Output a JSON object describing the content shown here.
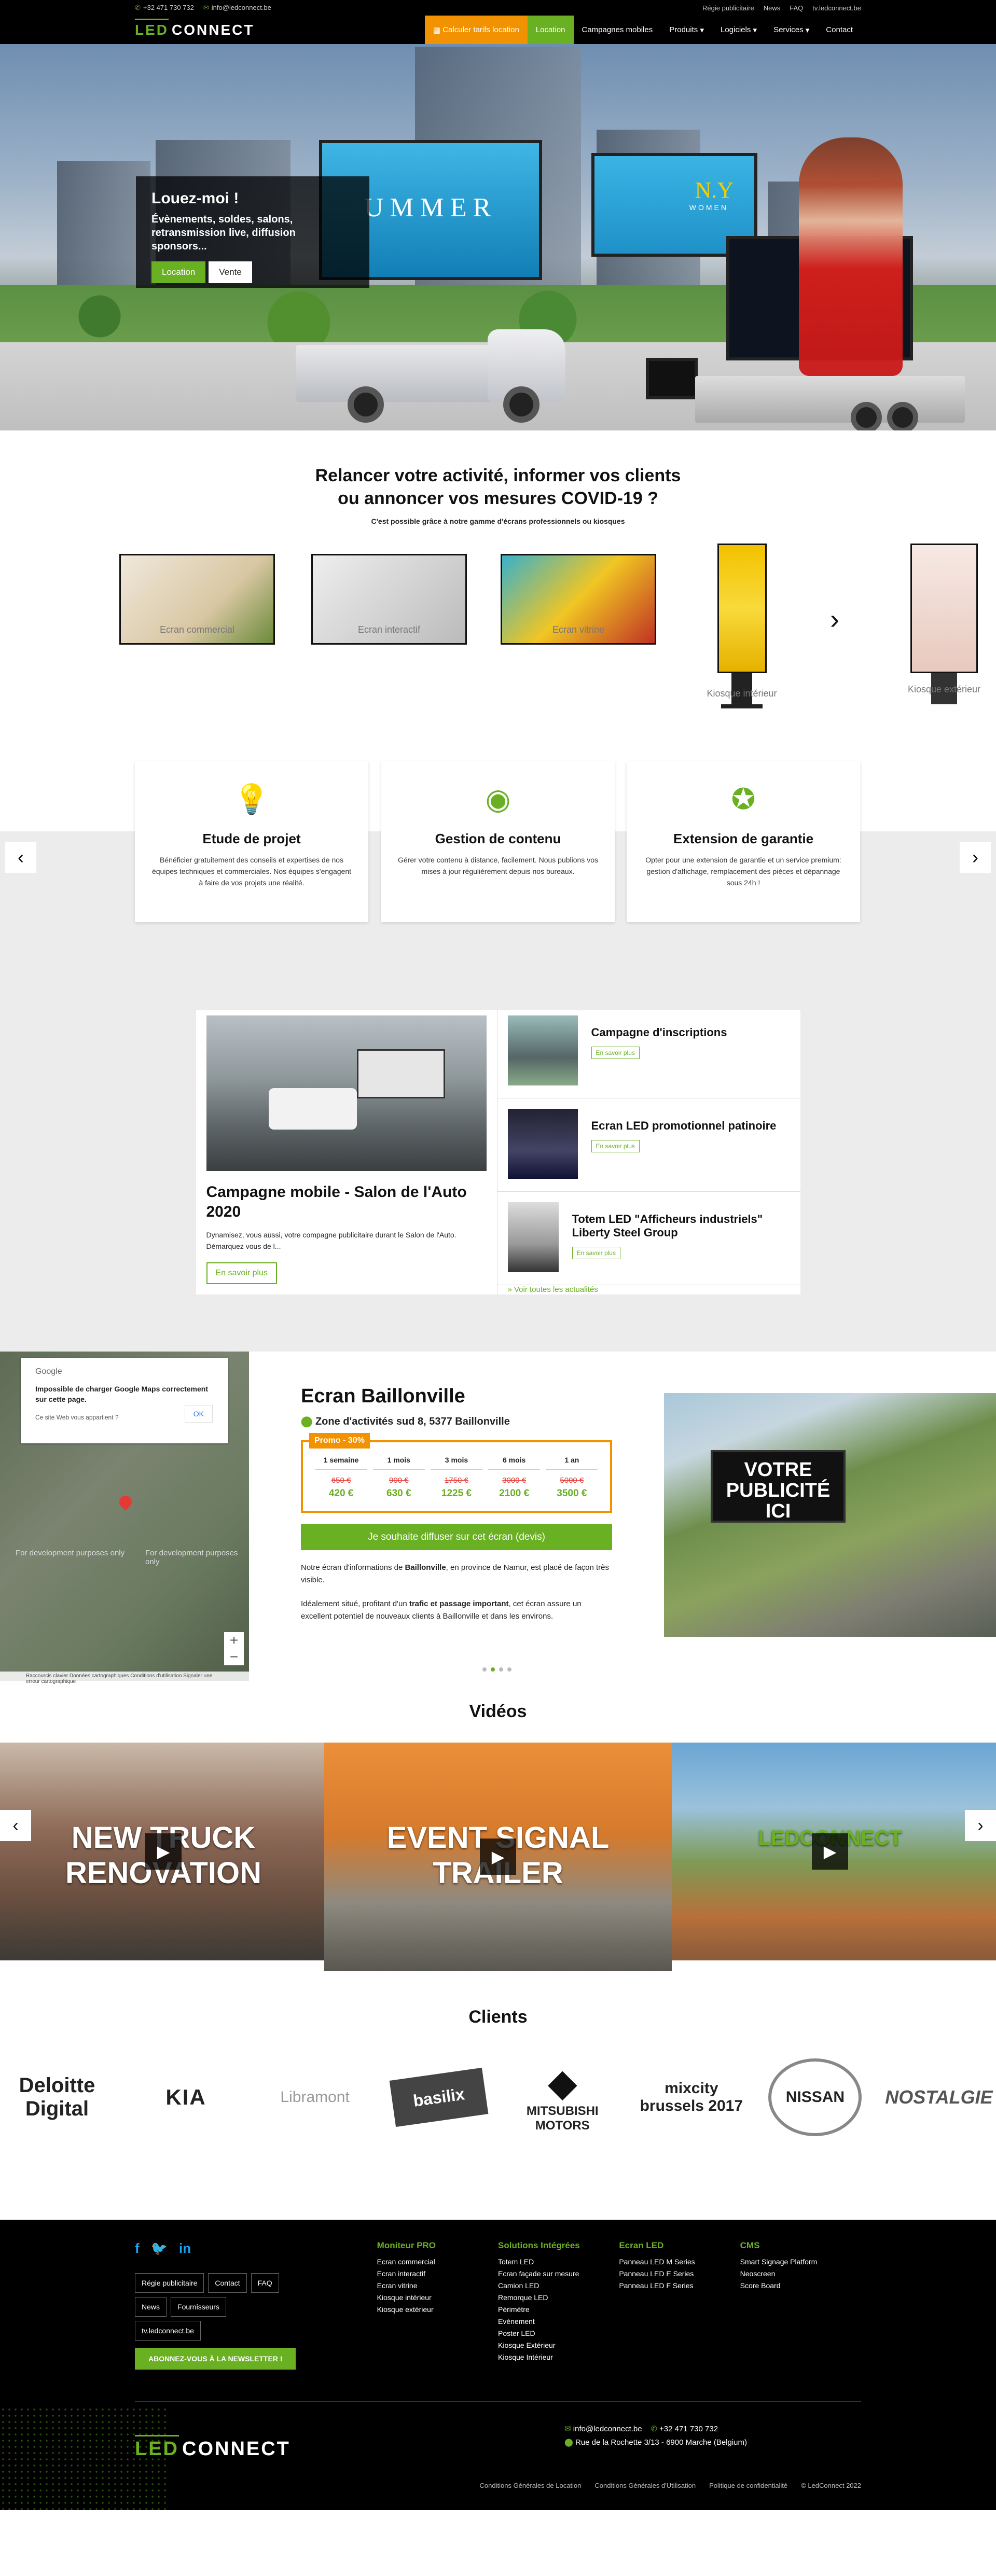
{
  "topbar": {
    "phone": "+32 471 730 732",
    "email": "info@ledconnect.be",
    "links": [
      "Régie publicitaire",
      "News",
      "FAQ",
      "tv.ledconnect.be"
    ]
  },
  "logo": {
    "part1": "LED",
    "part2": "CONNECT"
  },
  "nav": {
    "calc": "Calculer tarifs location",
    "items": [
      "Location",
      "Campagnes mobiles",
      "Produits",
      "Logiciels",
      "Services",
      "Contact"
    ]
  },
  "hero": {
    "title": "Louez-moi !",
    "text": "Évènements, soldes, salons, retransmission live, diffusion sponsors...",
    "btn_location": "Location",
    "btn_vente": "Vente",
    "screen1_text": "UMMER",
    "screen2_text": "N.Y",
    "screen2_sub": "WOMEN"
  },
  "covid": {
    "title_line1": "Relancer votre activité, informer vos clients",
    "title_line2": "ou annoncer vos mesures COVID-19 ?",
    "subtitle": "C'est possible grâce à notre gamme d'écrans professionnels ou kiosques",
    "products": [
      "Ecran commercial",
      "Ecran interactif",
      "Ecran vitrine",
      "Kiosque intérieur",
      "Kiosque extérieur"
    ]
  },
  "features": [
    {
      "title": "Etude de projet",
      "text": "Bénéficier gratuitement des conseils et expertises de nos équipes techniques et commerciales. Nos équipes s'engagent à faire de vos projets une réalité."
    },
    {
      "title": "Gestion de contenu",
      "text": "Gérer votre contenu à distance, facilement. Nous publions vos mises à jour régulièrement depuis nos bureaux."
    },
    {
      "title": "Extension de garantie",
      "text": "Opter pour une extension de garantie et un service premium: gestion d'affichage, remplacement des pièces et dépannage sous 24h !"
    }
  ],
  "news": {
    "featured": {
      "title": "Campagne mobile - Salon de l'Auto 2020",
      "text": "Dynamisez, vous aussi, votre compagne publicitaire durant le Salon de l'Auto. Démarquez vous de l...",
      "button": "En savoir plus"
    },
    "items": [
      {
        "title": "Campagne d'inscriptions",
        "button": "En savoir plus"
      },
      {
        "title": "Ecran LED promotionnel patinoire",
        "button": "En savoir plus"
      },
      {
        "title": "Totem LED \"Afficheurs industriels\" Liberty Steel Group",
        "button": "En savoir plus"
      }
    ],
    "see_all": "» Voir toutes les actualités"
  },
  "map": {
    "provider": "Google",
    "error": "Impossible de charger Google Maps correctement sur cette page.",
    "question": "Ce site Web vous appartient ?",
    "ok": "OK",
    "dev1": "For development purposes only",
    "dev2": "For development purposes only",
    "attribution": "Raccourcis clavier   Données cartographiques   Conditions d'utilisation   Signaler une erreur cartographique"
  },
  "location": {
    "title": "Ecran Baillonville",
    "address": "Zone d'activités sud 8, 5377 Baillonville",
    "promo": "Promo - 30%",
    "prices": [
      {
        "period": "1 semaine",
        "old": "650 €",
        "new": "420 €"
      },
      {
        "period": "1 mois",
        "old": "900 €",
        "new": "630 €"
      },
      {
        "period": "3 mois",
        "old": "1750 €",
        "new": "1225 €"
      },
      {
        "period": "6 mois",
        "old": "3000 €",
        "new": "2100 €"
      },
      {
        "period": "1 an",
        "old": "5000 €",
        "new": "3500 €"
      }
    ],
    "cta": "Je souhaite diffuser sur cet écran (devis)",
    "p1_a": "Notre écran d'informations de ",
    "p1_b": "Baillonville",
    "p1_c": ", en province de Namur, est placé de façon très visible.",
    "p2_a": "Idéalement situé, profitant d'un ",
    "p2_b": "trafic et passage important",
    "p2_c": ", cet écran assure un excellent potentiel de nouveaux clients à Baillonville et dans les environs.",
    "billboard": "VOTRE PUBLICITÉ ICI"
  },
  "videos": {
    "title": "Vidéos",
    "items": [
      {
        "label": "NEW TRUCK RENOVATION"
      },
      {
        "label": "EVENT SIGNAL TRAILER"
      },
      {
        "label": "LEDCONNECT"
      }
    ]
  },
  "clients": {
    "title": "Clients",
    "logos": [
      "Deloitte Digital",
      "KIA",
      "Libramont",
      "basilix",
      "MITSUBISHI MOTORS",
      "mixcity brussels 2017",
      "NISSAN",
      "NOSTALGIE"
    ]
  },
  "footer": {
    "buttons": [
      "Régie publicitaire",
      "Contact",
      "FAQ",
      "News",
      "Fournisseurs",
      "tv.ledconnect.be"
    ],
    "newsletter": "ABONNEZ-VOUS À LA NEWSLETTER !",
    "cols": [
      {
        "title": "Moniteur PRO",
        "items": [
          "Ecran commercial",
          "Ecran interactif",
          "Ecran vitrine",
          "Kiosque intérieur",
          "Kiosque extérieur"
        ]
      },
      {
        "title": "Solutions Intégrées",
        "items": [
          "Totem LED",
          "Ecran façade sur mesure",
          "Camion LED",
          "Remorque LED",
          "Périmètre",
          "Evènement",
          "Poster LED",
          "Kiosque Extérieur",
          "Kiosque Intérieur"
        ]
      },
      {
        "title": "Ecran LED",
        "items": [
          "Panneau LED M Series",
          "Panneau LED E Series",
          "Panneau LED F Series"
        ]
      },
      {
        "title": "CMS",
        "items": [
          "Smart Signage Platform",
          "Neoscreen",
          "Score Board"
        ]
      }
    ],
    "email": "info@ledconnect.be",
    "phone": "+32 471 730 732",
    "address": "Rue de la Rochette 3/13 - 6900 Marche (Belgium)",
    "legal": [
      "Conditions Générales de Location",
      "Conditions Générales d'Utilisation",
      "Politique de confidentialité",
      "© LedConnect 2022"
    ]
  },
  "colors": {
    "brand_green": "#6ab023",
    "accent_orange": "#f39200",
    "dark": "#000000"
  }
}
